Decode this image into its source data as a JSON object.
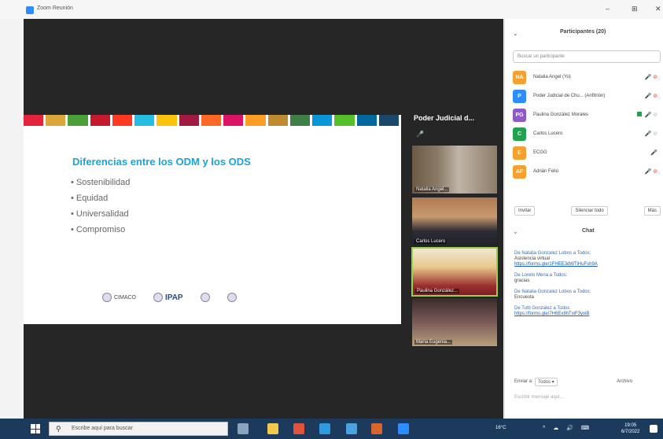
{
  "window": {
    "title": "Zoom Reunión",
    "controls": {
      "minimize": "–",
      "grid": "⊞",
      "close": "✕"
    }
  },
  "slide": {
    "title": "Diferencias entre los ODM y los ODS",
    "bullets": [
      "Sostenibilidad",
      "Equidad",
      "Universalidad",
      "Compromiso"
    ],
    "sdg_colors": [
      "#e5243b",
      "#dda63a",
      "#4c9f38",
      "#c5192d",
      "#ff3a21",
      "#26bde2",
      "#fcc30b",
      "#a21942",
      "#fd6925",
      "#dd1367",
      "#fd9d24",
      "#bf8b2e",
      "#3f7e44",
      "#0a97d9",
      "#56c02b",
      "#00689d",
      "#19486a"
    ],
    "logos": [
      {
        "name": "CIMAGO",
        "text": "CIMACO"
      },
      {
        "name": "ipap",
        "text": "IPAP"
      },
      {
        "name": "logo-3",
        "text": ""
      },
      {
        "name": "logo-4",
        "text": ""
      }
    ]
  },
  "tiles": {
    "header": "Poder Judicial d...",
    "participants": [
      {
        "label": "Natalia Angel..."
      },
      {
        "label": "Carlos Lucero"
      },
      {
        "label": "Paulina González..."
      },
      {
        "label": "María Eugenia..."
      }
    ]
  },
  "panel": {
    "title": "Participantes (20)",
    "search_placeholder": "Buscar un participante",
    "participants": [
      {
        "initials": "NA",
        "color": "#f7a030",
        "name": "Natalia Angel (Yo)",
        "icons": "🎤 ⊘",
        "muted": false,
        "video": false
      },
      {
        "initials": "P",
        "color": "#2d8cff",
        "name": "Poder Judicial de Chu... (Anfitrión)",
        "icons": "🎤 ⊘",
        "muted": false,
        "video": false
      },
      {
        "initials": "PG",
        "color": "#8e5ac8",
        "name": "Paulina González Morales",
        "icons": "🎤 ⊘",
        "muted": true,
        "video": true
      },
      {
        "initials": "C",
        "color": "#23a24d",
        "name": "Carlos Lucero",
        "icons": "🎤 ⊘",
        "muted": true,
        "video": false
      },
      {
        "initials": "E",
        "color": "#f7a030",
        "name": "ECGG",
        "icons": "🎤",
        "muted": false,
        "video": false
      },
      {
        "initials": "AF",
        "color": "#f7a030",
        "name": "Adrián Feliú",
        "icons": "🎤 ⊘",
        "muted": false,
        "video": false
      }
    ],
    "buttons": {
      "invite": "Invitar",
      "mute_all": "Silenciar todo",
      "more": "Más"
    },
    "chat": {
      "title": "Chat",
      "messages": [
        {
          "from": "De Natalia Gonzalez Lobos  a Todos:",
          "body": "Asistencia virtual",
          "link": "https://forms.gle/1FHEE3dWTiHuFsh9A"
        },
        {
          "from": "De Loreto Mena  a Todos:",
          "body": "gracias",
          "link": ""
        },
        {
          "from": "De Natalia Gonzalez Lobos  a Todos:",
          "body": "Encuesta",
          "link": ""
        },
        {
          "from": "De Tutti Gonzalez  a Todos:",
          "body": "",
          "link": "https://forms.gle/7H6Ex8hTxiF3yxiB"
        }
      ],
      "send_to_label": "Enviar a:",
      "send_to_value": "Todos ▾",
      "files_label": "Archivo",
      "input_placeholder": "Escribir mensaje aquí..."
    }
  },
  "taskbar": {
    "search_placeholder": "Escribe aquí para buscar",
    "apps": [
      {
        "name": "task-view",
        "color": "#8aa4c0"
      },
      {
        "name": "file-explorer",
        "color": "#f2c94c"
      },
      {
        "name": "chrome",
        "color": "#e0533d"
      },
      {
        "name": "edge",
        "color": "#2f9bde"
      },
      {
        "name": "store",
        "color": "#4aa3df"
      },
      {
        "name": "powerpoint",
        "color": "#d9652c"
      },
      {
        "name": "zoom",
        "color": "#2d8cff"
      }
    ],
    "weather": "16°C",
    "time": "19:05",
    "date": "6/7/2022"
  }
}
